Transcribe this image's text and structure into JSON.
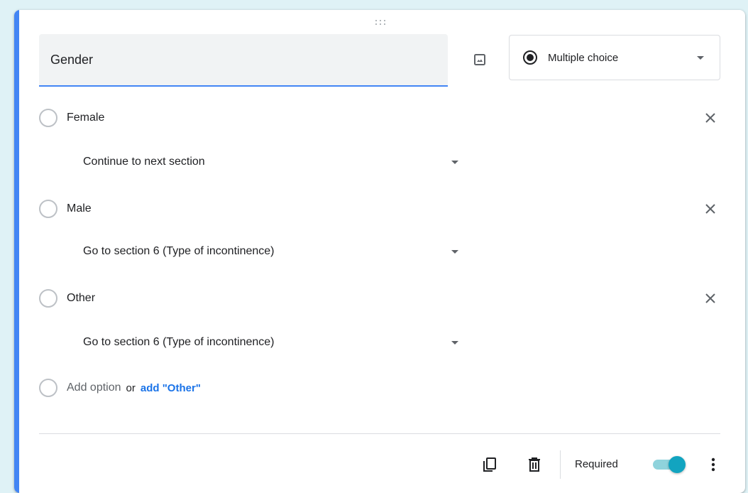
{
  "question": {
    "title": "Gender",
    "type_label": "Multiple choice"
  },
  "options": [
    {
      "label": "Female",
      "goto": "Continue to next section"
    },
    {
      "label": "Male",
      "goto": "Go to section 6 (Type of incontinence)"
    },
    {
      "label": "Other",
      "goto": "Go to section 6 (Type of incontinence)"
    }
  ],
  "add_option": {
    "label": "Add option",
    "or": "or",
    "add_other": "add \"Other\""
  },
  "footer": {
    "required_label": "Required",
    "required_on": true
  },
  "colors": {
    "accent": "#4285f4",
    "link": "#1a73e8",
    "toggle": "#12a4c0"
  },
  "icons": [
    "drag-handle-icon",
    "image-icon",
    "radio-checked-icon",
    "caret-down-icon",
    "close-icon",
    "copy-icon",
    "trash-icon",
    "more-vert-icon"
  ]
}
